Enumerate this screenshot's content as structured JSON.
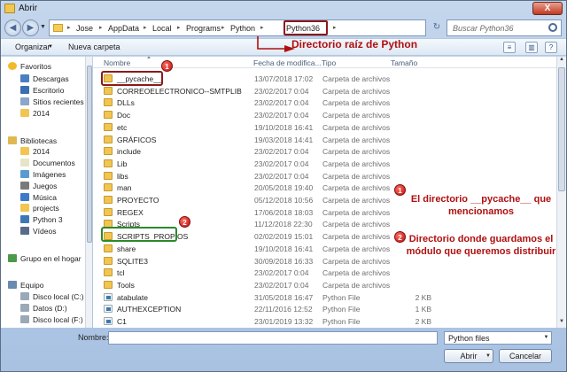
{
  "window": {
    "title": "Abrir",
    "close_glyph": "X"
  },
  "address": {
    "crumbs": [
      "Jose",
      "AppData",
      "Local",
      "Programs",
      "Python",
      "Python36"
    ],
    "search_placeholder": "Buscar Python36"
  },
  "toolbar": {
    "organize": "Organizar",
    "new_folder": "Nueva carpeta"
  },
  "annotations": {
    "root": "Directorio raíz de Python",
    "badge1": "1",
    "badge2": "2",
    "note1": "El directorio __pycache__ que mencionamos",
    "note2": "Directorio donde guardamos el módulo que queremos distribuir"
  },
  "nav": [
    {
      "label": "Favoritos",
      "icon": "star-icon",
      "color": "#f2b92a",
      "indent": 0
    },
    {
      "label": "Descargas",
      "icon": "download-folder-icon",
      "color": "#4a7fc0",
      "indent": 1
    },
    {
      "label": "Escritorio",
      "icon": "desktop-icon",
      "color": "#3a6fb0",
      "indent": 1
    },
    {
      "label": "Sitios recientes",
      "icon": "recent-places-icon",
      "color": "#8aa6c8",
      "indent": 1
    },
    {
      "label": "2014",
      "icon": "folder-icon",
      "color": "#f2c552",
      "indent": 1
    },
    {
      "label": "Bibliotecas",
      "icon": "libraries-icon",
      "color": "#e0b850",
      "indent": 0
    },
    {
      "label": "2014",
      "icon": "folder-icon",
      "color": "#f2c552",
      "indent": 1
    },
    {
      "label": "Documentos",
      "icon": "documents-icon",
      "color": "#e8e4c8",
      "indent": 1
    },
    {
      "label": "Imágenes",
      "icon": "pictures-icon",
      "color": "#5a9ad0",
      "indent": 1
    },
    {
      "label": "Juegos",
      "icon": "games-icon",
      "color": "#7a7a7a",
      "indent": 1
    },
    {
      "label": "Música",
      "icon": "music-icon",
      "color": "#3a7ac8",
      "indent": 1
    },
    {
      "label": "projects",
      "icon": "folder-icon",
      "color": "#f2c552",
      "indent": 1
    },
    {
      "label": "Python 3",
      "icon": "python-icon",
      "color": "#3d78b5",
      "indent": 1
    },
    {
      "label": "Vídeos",
      "icon": "videos-icon",
      "color": "#5a6a8a",
      "indent": 1
    },
    {
      "label": "Grupo en el hogar",
      "icon": "homegroup-icon",
      "color": "#4a9a4a",
      "indent": 0
    },
    {
      "label": "Equipo",
      "icon": "computer-icon",
      "color": "#6a8ab0",
      "indent": 0
    },
    {
      "label": "Disco local (C:)",
      "icon": "drive-icon",
      "color": "#9aa8b8",
      "indent": 1
    },
    {
      "label": "Datos (D:)",
      "icon": "drive-icon",
      "color": "#9aa8b8",
      "indent": 1
    },
    {
      "label": "Disco local (F:)",
      "icon": "drive-icon",
      "color": "#9aa8b8",
      "indent": 1
    }
  ],
  "columns": {
    "name": "Nombre",
    "date": "Fecha de modifica...",
    "type": "Tipo",
    "size": "Tamaño"
  },
  "files": [
    {
      "name": "__pycache__",
      "date": "13/07/2018 17:02",
      "type": "Carpeta de archivos",
      "size": "",
      "kind": "folder"
    },
    {
      "name": "CORREOELECTRONICO--SMTPLIB",
      "date": "23/02/2017 0:04",
      "type": "Carpeta de archivos",
      "size": "",
      "kind": "folder"
    },
    {
      "name": "DLLs",
      "date": "23/02/2017 0:04",
      "type": "Carpeta de archivos",
      "size": "",
      "kind": "folder"
    },
    {
      "name": "Doc",
      "date": "23/02/2017 0:04",
      "type": "Carpeta de archivos",
      "size": "",
      "kind": "folder"
    },
    {
      "name": "etc",
      "date": "19/10/2018 16:41",
      "type": "Carpeta de archivos",
      "size": "",
      "kind": "folder"
    },
    {
      "name": "GRÁFICOS",
      "date": "19/03/2018 14:41",
      "type": "Carpeta de archivos",
      "size": "",
      "kind": "folder"
    },
    {
      "name": "include",
      "date": "23/02/2017 0:04",
      "type": "Carpeta de archivos",
      "size": "",
      "kind": "folder"
    },
    {
      "name": "Lib",
      "date": "23/02/2017 0:04",
      "type": "Carpeta de archivos",
      "size": "",
      "kind": "folder"
    },
    {
      "name": "libs",
      "date": "23/02/2017 0:04",
      "type": "Carpeta de archivos",
      "size": "",
      "kind": "folder"
    },
    {
      "name": "man",
      "date": "20/05/2018 19:40",
      "type": "Carpeta de archivos",
      "size": "",
      "kind": "folder"
    },
    {
      "name": "PROYECTO",
      "date": "05/12/2018 10:56",
      "type": "Carpeta de archivos",
      "size": "",
      "kind": "folder"
    },
    {
      "name": "REGEX",
      "date": "17/06/2018 18:03",
      "type": "Carpeta de archivos",
      "size": "",
      "kind": "folder"
    },
    {
      "name": "Scripts",
      "date": "11/12/2018 22:30",
      "type": "Carpeta de archivos",
      "size": "",
      "kind": "folder"
    },
    {
      "name": "SCRIPTS_PROPIOS",
      "date": "02/02/2019 15:01",
      "type": "Carpeta de archivos",
      "size": "",
      "kind": "folder"
    },
    {
      "name": "share",
      "date": "19/10/2018 16:41",
      "type": "Carpeta de archivos",
      "size": "",
      "kind": "folder"
    },
    {
      "name": "SQLITE3",
      "date": "30/09/2018 16:33",
      "type": "Carpeta de archivos",
      "size": "",
      "kind": "folder"
    },
    {
      "name": "tcl",
      "date": "23/02/2017 0:04",
      "type": "Carpeta de archivos",
      "size": "",
      "kind": "folder"
    },
    {
      "name": "Tools",
      "date": "23/02/2017 0:04",
      "type": "Carpeta de archivos",
      "size": "",
      "kind": "folder"
    },
    {
      "name": "atabulate",
      "date": "31/05/2018 16:47",
      "type": "Python File",
      "size": "2 KB",
      "kind": "py"
    },
    {
      "name": "AUTHEXCEPTION",
      "date": "22/11/2016 12:52",
      "type": "Python File",
      "size": "1 KB",
      "kind": "py"
    },
    {
      "name": "C1",
      "date": "23/01/2019 13:32",
      "type": "Python File",
      "size": "2 KB",
      "kind": "py"
    }
  ],
  "footer": {
    "name_label": "Nombre:",
    "name_value": "",
    "filter": "Python files",
    "open": "Abrir",
    "cancel": "Cancelar"
  },
  "colors": {
    "annotation_red": "#b01010",
    "highlight_green": "#2a8a2a",
    "highlight_red": "#8b1a1a"
  }
}
